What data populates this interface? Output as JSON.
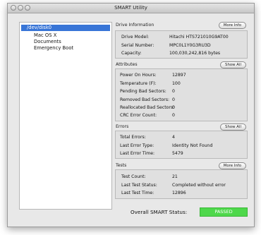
{
  "window": {
    "title": "SMART Utility"
  },
  "sidebar": {
    "disk": "/dev/disk0",
    "volumes": [
      "Mac OS X",
      "Documents",
      "Emergency Boot"
    ]
  },
  "drive_info": {
    "title": "Drive Information",
    "button": "More Info",
    "rows": [
      {
        "label": "Drive Model:",
        "value": "Hitachi HTS721010G9AT00"
      },
      {
        "label": "Serial Number:",
        "value": "MPC0L1Y0G3RU3D"
      },
      {
        "label": "Capacity:",
        "value": "100,030,242,816 bytes"
      }
    ]
  },
  "attributes": {
    "title": "Attributes",
    "button": "Show All",
    "rows": [
      {
        "label": "Power On Hours:",
        "value": "12897"
      },
      {
        "label": "Temperature (F):",
        "value": "100"
      },
      {
        "label": "Pending Bad Sectors:",
        "value": "0"
      },
      {
        "label": "Removed Bad Sectors:",
        "value": "0"
      },
      {
        "label": "Reallocated Bad Sectors:",
        "value": "0"
      },
      {
        "label": "CRC Error Count:",
        "value": "0"
      }
    ]
  },
  "errors": {
    "title": "Errors",
    "button": "Show All",
    "rows": [
      {
        "label": "Total Errors:",
        "value": "4"
      },
      {
        "label": "Last Error Type:",
        "value": "Identity Not Found"
      },
      {
        "label": "Last Error Time:",
        "value": "5479"
      }
    ]
  },
  "tests": {
    "title": "Tests",
    "button": "More Info",
    "rows": [
      {
        "label": "Test Count:",
        "value": "21"
      },
      {
        "label": "Last Test Status:",
        "value": "Completed without error"
      },
      {
        "label": "Last Test Time:",
        "value": "12896"
      }
    ]
  },
  "overall": {
    "label": "Overall SMART Status:",
    "status": "PASSED",
    "status_color": "#4ed84b"
  }
}
